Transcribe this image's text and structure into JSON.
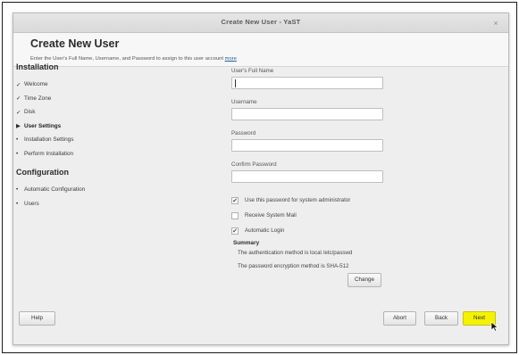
{
  "window": {
    "title": "Create New User - YaST",
    "close_glyph": "×"
  },
  "header": {
    "title": "Create New User",
    "subtitle": "Enter the User's Full Name, Username, and Password to assign to this user account",
    "more_link": "more"
  },
  "sidebar": {
    "sections": [
      {
        "title": "Installation",
        "items": [
          {
            "marker": "✓",
            "label": "Welcome",
            "state": "done"
          },
          {
            "marker": "✓",
            "label": "Time Zone",
            "state": "done"
          },
          {
            "marker": "✓",
            "label": "Disk",
            "state": "done"
          },
          {
            "marker": "▶",
            "label": "User Settings",
            "state": "current"
          },
          {
            "marker": "•",
            "label": "Installation Settings",
            "state": "pending"
          },
          {
            "marker": "•",
            "label": "Perform Installation",
            "state": "pending"
          }
        ]
      },
      {
        "title": "Configuration",
        "items": [
          {
            "marker": "•",
            "label": "Automatic Configuration",
            "state": "pending"
          },
          {
            "marker": "•",
            "label": "Users",
            "state": "pending"
          }
        ]
      }
    ]
  },
  "form": {
    "full_name_label": "User's Full Name",
    "full_name_value": "",
    "username_label": "Username",
    "username_value": "",
    "password_label": "Password",
    "password_value": "",
    "confirm_label": "Confirm Password",
    "confirm_value": "",
    "checkboxes": [
      {
        "label": "Use this password for system administrator",
        "checked": true
      },
      {
        "label": "Receive System Mail",
        "checked": false
      },
      {
        "label": "Automatic Login",
        "checked": true
      }
    ]
  },
  "summary": {
    "title": "Summary",
    "lines": [
      "The authentication method is local /etc/passwd",
      "The password encryption method is SHA-512"
    ],
    "change_label": "Change"
  },
  "buttons": {
    "help": "Help",
    "abort": "Abort",
    "back": "Back",
    "next": "Next"
  },
  "colors": {
    "next_highlight": "#f5f200",
    "link": "#1f5fa8"
  }
}
